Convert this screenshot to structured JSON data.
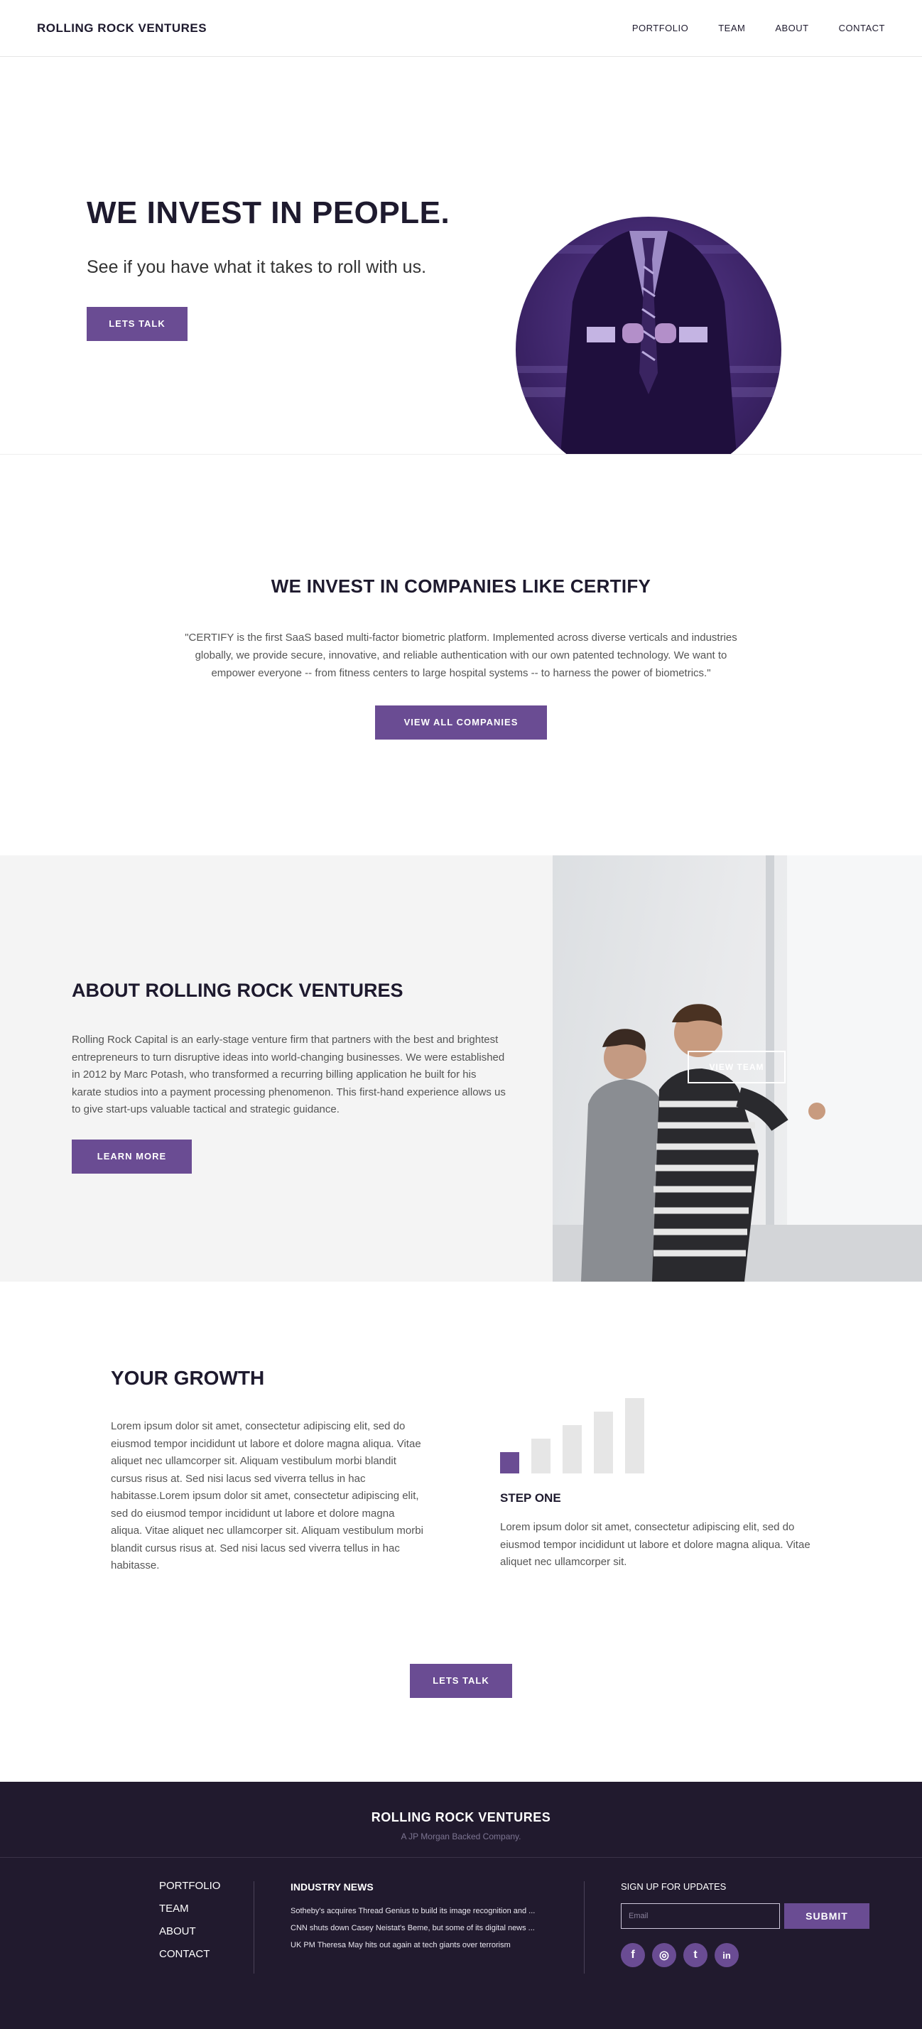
{
  "nav": {
    "brand": "ROLLING ROCK VENTURES",
    "links": [
      "PORTFOLIO",
      "TEAM",
      "ABOUT",
      "CONTACT"
    ]
  },
  "hero": {
    "title": "WE INVEST IN PEOPLE.",
    "subtitle": "See if you have what it takes to roll with us.",
    "button": "LETS TALK"
  },
  "companies": {
    "title": "WE INVEST IN COMPANIES LIKE CERTIFY",
    "text": "\"CERTIFY is the first SaaS based multi-factor biometric platform. Implemented across diverse verticals and industries globally, we provide secure, innovative, and reliable authentication with our own patented technology. We want to empower everyone -- from fitness centers to large hospital systems -- to harness the power of biometrics.\"",
    "button": "VIEW ALL COMPANIES"
  },
  "about": {
    "title": "ABOUT ROLLING ROCK VENTURES",
    "text": "Rolling Rock Capital is an early-stage venture firm that partners with the best and brightest entrepreneurs to turn disruptive ideas into world-changing businesses. We were established in 2012 by Marc Potash, who transformed a recurring billing application he built for his karate studios into a payment processing phenomenon. This first-hand experience allows us to give start-ups valuable tactical and strategic guidance.",
    "button": "LEARN MORE",
    "image_button": "VIEW TEAM"
  },
  "growth": {
    "title": "YOUR GROWTH",
    "text": "Lorem ipsum dolor sit amet, consectetur adipiscing elit, sed do eiusmod tempor incididunt ut labore et dolore magna aliqua. Vitae aliquet nec ullamcorper sit. Aliquam vestibulum morbi blandit cursus risus at. Sed nisi lacus sed viverra tellus in hac habitasse.Lorem ipsum dolor sit amet, consectetur adipiscing elit, sed do eiusmod tempor incididunt ut labore et dolore magna aliqua. Vitae aliquet nec ullamcorper sit. Aliquam vestibulum morbi blandit cursus risus at. Sed nisi lacus sed viverra tellus in hac habitasse.",
    "steps_total": 5,
    "active_step": 1,
    "step_title": "STEP ONE",
    "step_text": "Lorem ipsum dolor sit amet, consectetur adipiscing elit, sed do eiusmod tempor incididunt ut labore et dolore magna aliqua. Vitae aliquet nec ullamcorper sit.",
    "button": "LETS TALK"
  },
  "footer": {
    "brand": "ROLLING ROCK VENTURES",
    "tagline": "A JP Morgan Backed Company.",
    "links": [
      "PORTFOLIO",
      "TEAM",
      "ABOUT",
      "CONTACT"
    ],
    "news_title": "INDUSTRY NEWS",
    "news": [
      "Sotheby's acquires Thread Genius to build its image recognition and ...",
      "CNN shuts down Casey Neistat's Beme, but some of its digital news ...",
      "UK PM Theresa May hits out again at tech giants over terrorism"
    ],
    "signup_label": "SIGN UP FOR UPDATES",
    "email_placeholder": "Email",
    "submit": "SUBMIT",
    "socials": [
      {
        "icon": "facebook-icon",
        "glyph": "f"
      },
      {
        "icon": "instagram-icon",
        "glyph": "◎"
      },
      {
        "icon": "twitter-icon",
        "glyph": "t"
      },
      {
        "icon": "linkedin-icon",
        "glyph": "in"
      }
    ]
  },
  "colors": {
    "accent": "#6a4c93",
    "dark": "#211a2e",
    "text": "#1e1a2e",
    "muted_bg": "#f4f4f4"
  }
}
